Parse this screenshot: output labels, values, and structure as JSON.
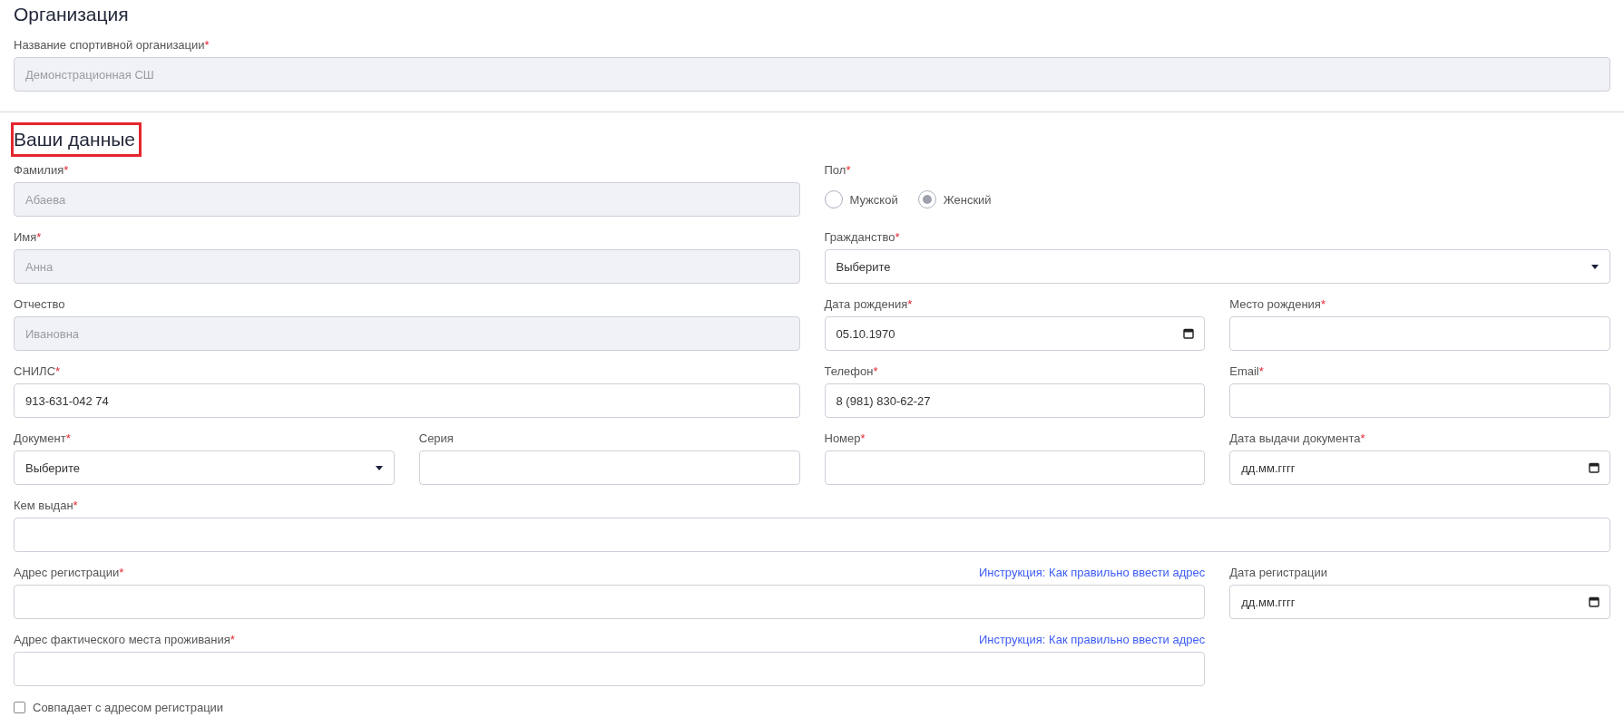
{
  "organization": {
    "title": "Организация",
    "fields": [
      {
        "kind": "text",
        "label": "Название спортивной организации",
        "required_mark": "*",
        "value": "Демонстрационная СШ",
        "disabled": true
      }
    ]
  },
  "personal": {
    "title": "Ваши данные",
    "highlighted": true,
    "fields": [
      {
        "kind": "text",
        "label": "Фамилия",
        "required_mark": "*",
        "value": "Абаева",
        "disabled": true
      },
      {
        "kind": "radio",
        "label": "Пол",
        "required_mark": "*",
        "options": [
          {
            "label": "Мужской",
            "selected": false
          },
          {
            "label": "Женский",
            "selected": true
          }
        ]
      },
      {
        "kind": "text",
        "label": "Имя",
        "required_mark": "*",
        "value": "Анна",
        "disabled": true
      },
      {
        "kind": "select",
        "label": "Гражданство",
        "required_mark": "*",
        "value": "Выберите"
      },
      {
        "kind": "text",
        "label": "Отчество",
        "value": "Ивановна",
        "disabled": true
      },
      {
        "kind": "date",
        "label": "Дата рождения",
        "required_mark": "*",
        "value": "05.10.1970"
      },
      {
        "kind": "text",
        "label": "Место рождения",
        "required_mark": "*",
        "disabled": false
      },
      {
        "kind": "text",
        "label": "СНИЛС",
        "required_mark": "*",
        "value": "913-631-042 74",
        "disabled": false
      },
      {
        "kind": "text",
        "label": "Телефон",
        "required_mark": "*",
        "value": "8 (981) 830-62-27",
        "disabled": false
      },
      {
        "kind": "text",
        "label": "Email",
        "required_mark": "*",
        "disabled": false
      },
      {
        "kind": "select",
        "label": "Документ",
        "required_mark": "*",
        "value": "Выберите"
      },
      {
        "kind": "text",
        "label": "Серия",
        "disabled": false
      },
      {
        "kind": "text",
        "label": "Номер",
        "required_mark": "*",
        "disabled": false
      },
      {
        "kind": "date",
        "label": "Дата выдачи документа",
        "required_mark": "*",
        "placeholder": "дд.мм.гггг"
      },
      {
        "kind": "text",
        "label": "Кем выдан",
        "required_mark": "*",
        "disabled": false
      },
      {
        "kind": "text",
        "label": "Адрес регистрации",
        "required_mark": "*",
        "link": "Инструкция: Как правильно ввести адрес",
        "disabled": false
      },
      {
        "kind": "date",
        "label": "Дата регистрации",
        "placeholder": "дд.мм.гггг"
      },
      {
        "kind": "text",
        "label": "Адрес фактического места проживания",
        "required_mark": "*",
        "link": "Инструкция: Как правильно ввести адрес",
        "disabled": false
      },
      {
        "kind": "checkbox",
        "label": "Совпадает с адресом регистрации",
        "checked": false
      }
    ]
  }
}
